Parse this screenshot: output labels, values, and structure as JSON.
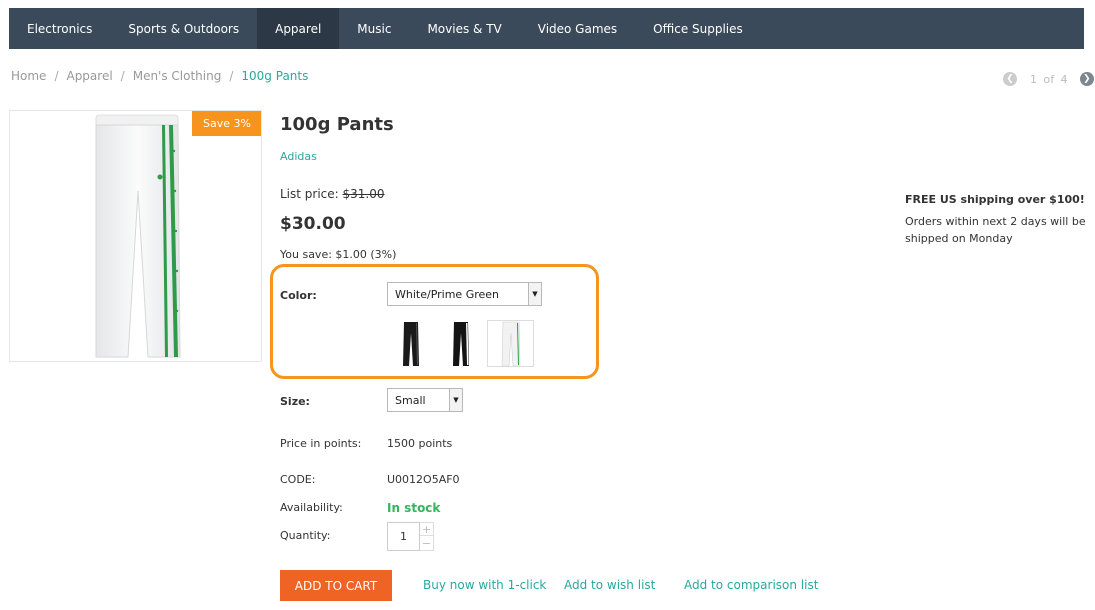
{
  "nav": {
    "items": [
      {
        "label": "Electronics"
      },
      {
        "label": "Sports & Outdoors"
      },
      {
        "label": "Apparel"
      },
      {
        "label": "Music"
      },
      {
        "label": "Movies & TV"
      },
      {
        "label": "Video Games"
      },
      {
        "label": "Office Supplies"
      }
    ],
    "active": "Apparel"
  },
  "breadcrumb": {
    "items": [
      "Home",
      "Apparel",
      "Men's Clothing"
    ],
    "current": "100g Pants",
    "separator": "/"
  },
  "pager": {
    "current": "1",
    "of_label": "of",
    "total": "4"
  },
  "product": {
    "badge": "Save 3%",
    "title": "100g Pants",
    "brand": "Adidas",
    "list_price_label": "List price:",
    "list_price": "$31.00",
    "price": "$30.00",
    "you_save": "You save: $1.00 (3%)"
  },
  "options": {
    "color_label": "Color:",
    "color_value": "White/Prime Green",
    "swatches": [
      {
        "name": "black pants",
        "color": "#1a1a1a"
      },
      {
        "name": "black pants with white stripes",
        "color": "#141414"
      },
      {
        "name": "white pants with green stripes",
        "color": "#f2f2f2",
        "selected": true
      }
    ],
    "size_label": "Size:",
    "size_value": "Small"
  },
  "details": {
    "points_label": "Price in points:",
    "points_value": "1500 points",
    "code_label": "CODE:",
    "code_value": "U0012O5AF0",
    "availability_label": "Availability:",
    "availability_value": "In stock",
    "quantity_label": "Quantity:",
    "quantity_value": "1"
  },
  "actions": {
    "add_to_cart": "ADD TO CART",
    "buy_now": "Buy now with 1-click",
    "wish_list": "Add to wish list",
    "comparison": "Add to comparison list"
  },
  "shipping": {
    "title": "FREE US shipping over $100!",
    "text": "Orders within next 2 days will be shipped on Monday"
  },
  "colors": {
    "nav_bg": "#3b4a5a",
    "accent_teal": "#28a8a0",
    "badge_orange": "#f7941d",
    "cart_orange": "#ef6424",
    "stock_green": "#35b55f"
  }
}
